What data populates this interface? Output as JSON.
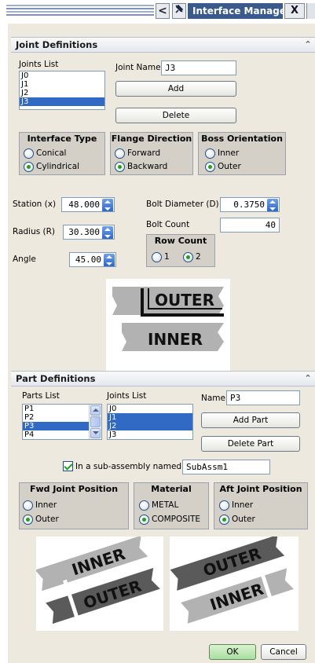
{
  "window": {
    "title": "Interface Manager",
    "back_glyph": "<",
    "pin_icon": "pin-icon",
    "close_glyph": "X"
  },
  "joint_definitions": {
    "header": "Joint Definitions",
    "joints_list_label": "Joints List",
    "joints": [
      "J0",
      "J1",
      "J2",
      "J3"
    ],
    "selected_joint": "J3",
    "joint_name_label": "Joint Name",
    "joint_name_value": "J3",
    "add_label": "Add",
    "delete_label": "Delete",
    "interface_type": {
      "title": "Interface Type",
      "options": [
        "Conical",
        "Cylindrical"
      ],
      "selected": "Cylindrical"
    },
    "flange_direction": {
      "title": "Flange Direction",
      "options": [
        "Forward",
        "Backward"
      ],
      "selected": "Backward"
    },
    "boss_orientation": {
      "title": "Boss Orientation",
      "options": [
        "Inner",
        "Outer"
      ],
      "selected": "Outer"
    },
    "station_label": "Station (x)",
    "station_value": "48.000",
    "radius_label": "Radius (R)",
    "radius_value": "30.300",
    "angle_label": "Angle",
    "angle_value": "45.00",
    "bolt_diameter_label": "Bolt Diameter (D)",
    "bolt_diameter_value": "0.3750",
    "bolt_count_label": "Bolt Count",
    "bolt_count_value": "40",
    "row_count": {
      "title": "Row Count",
      "options": [
        "1",
        "2"
      ],
      "selected": "2"
    },
    "illustration": {
      "top_text": "OUTER",
      "bottom_text": "INNER"
    }
  },
  "part_definitions": {
    "header": "Part Definitions",
    "parts_list_label": "Parts List",
    "parts": [
      "P1",
      "P2",
      "P3",
      "P4"
    ],
    "selected_part": "P3",
    "joints_list_label": "Joints List",
    "joints": [
      "J0",
      "J1",
      "J2",
      "J3"
    ],
    "selected_joints": [
      "J1",
      "J2"
    ],
    "name_label": "Name",
    "name_value": "P3",
    "add_part_label": "Add Part",
    "delete_part_label": "Delete Part",
    "subassembly_checkbox_label": "In a sub-assembly named",
    "subassembly_checked": true,
    "subassembly_name": "SubAssm1",
    "fwd_joint_position": {
      "title": "Fwd Joint Position",
      "options": [
        "Inner",
        "Outer"
      ],
      "selected": "Outer"
    },
    "material": {
      "title": "Material",
      "options": [
        "METAL",
        "COMPOSITE"
      ],
      "selected": "COMPOSITE"
    },
    "aft_joint_position": {
      "title": "Aft Joint Position",
      "options": [
        "Inner",
        "Outer"
      ],
      "selected": "Outer"
    },
    "left_illustration": {
      "top_text": "INNER",
      "bottom_text": "OUTER"
    },
    "right_illustration": {
      "top_text": "OUTER",
      "bottom_text": "INNER"
    }
  },
  "footer": {
    "ok_label": "OK",
    "cancel_label": "Cancel"
  },
  "colors": {
    "title_bg": "#3a5a8e",
    "selection": "#316ac5",
    "radio_on": "#21a121",
    "panel_bg": "#ede9de"
  }
}
